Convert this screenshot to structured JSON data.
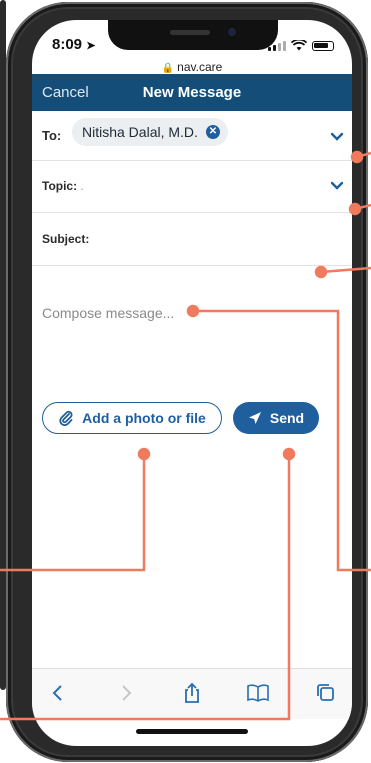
{
  "status": {
    "time": "8:09"
  },
  "browser": {
    "url": "nav.care"
  },
  "navbar": {
    "cancel": "Cancel",
    "title": "New Message"
  },
  "to": {
    "label": "To:",
    "recipient": "Nitisha Dalal, M.D."
  },
  "topic": {
    "label": "Topic:",
    "value": "."
  },
  "subject": {
    "label": "Subject:"
  },
  "compose": {
    "placeholder": "Compose message..."
  },
  "actions": {
    "attach": "Add a photo or file",
    "send": "Send"
  },
  "colors": {
    "primary": "#1f5f9e",
    "navbar": "#144e78",
    "annotation": "#f07a5e"
  },
  "icons": [
    "location-arrow-icon",
    "lock-icon",
    "signal-icon",
    "wifi-icon",
    "battery-icon",
    "chevron-down-icon",
    "remove-recipient-icon",
    "paperclip-icon",
    "send-icon",
    "back-icon",
    "forward-icon",
    "share-icon",
    "bookmarks-icon",
    "tabs-icon"
  ]
}
